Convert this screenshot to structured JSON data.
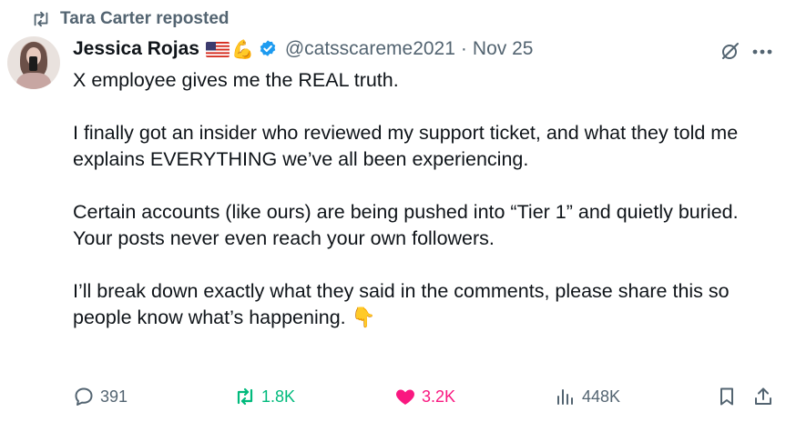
{
  "repost": {
    "text": "Tara Carter reposted",
    "icon": "repost-icon"
  },
  "author": {
    "name": "Jessica Rojas",
    "emoji_flag": "us-flag-icon",
    "emoji_muscle": "💪",
    "verified": true,
    "handle": "@catsscareme2021",
    "separator": "·",
    "date": "Nov 25"
  },
  "tweet": {
    "p1": "X employee gives me the REAL truth.",
    "p2": "I finally got an insider who reviewed my support ticket,  and what they told me explains EVERYTHING we’ve all been experiencing.",
    "p3a": "Certain accounts (like ours) are being pushed into “Tier 1” and quietly buried.",
    "p3b": "Your posts never even reach your own followers.",
    "p4": "I’ll break down exactly what they said in the comments, please share this so people know what’s happening. 👇"
  },
  "actions": {
    "replies": "391",
    "reposts": "1.8K",
    "likes": "3.2K",
    "views": "448K"
  },
  "colors": {
    "secondary": "#536471",
    "repost_green": "#00ba7c",
    "like_pink": "#f91880",
    "verified_blue": "#1d9bf0"
  }
}
